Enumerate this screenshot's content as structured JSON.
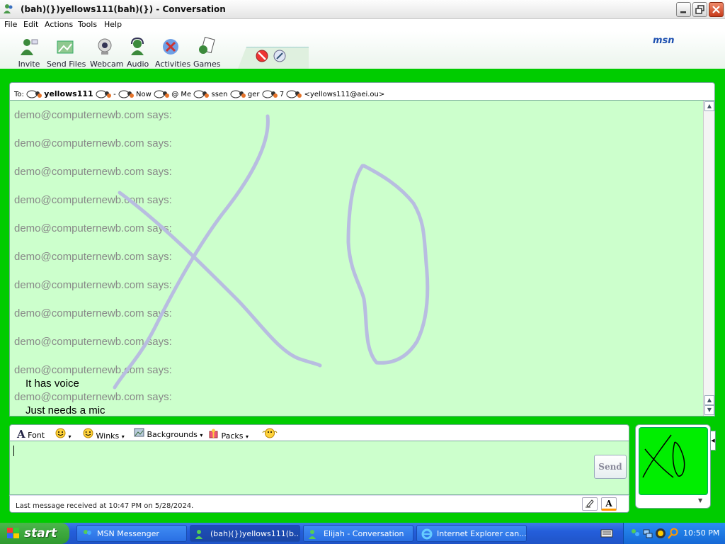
{
  "window": {
    "title": "(bah)(})yellows111(bah)(}) - Conversation"
  },
  "menu": [
    "File",
    "Edit",
    "Actions",
    "Tools",
    "Help"
  ],
  "toolbar": {
    "buttons": [
      "Invite",
      "Send Files",
      "Webcam",
      "Audio",
      "Activities",
      "Games"
    ],
    "brand": "msn"
  },
  "to_bar": {
    "prefix": "To:",
    "nick": "yellows111",
    "fragments": [
      "-",
      "Now",
      "@ Me",
      "ssen",
      "ger",
      "7"
    ],
    "email": "<yellows111@aei.ou>"
  },
  "history": {
    "messages": [
      {
        "sender": "demo@computernewb.com says:",
        "text": ""
      },
      {
        "sender": "demo@computernewb.com says:",
        "text": ""
      },
      {
        "sender": "demo@computernewb.com says:",
        "text": ""
      },
      {
        "sender": "demo@computernewb.com says:",
        "text": ""
      },
      {
        "sender": "demo@computernewb.com says:",
        "text": ""
      },
      {
        "sender": "demo@computernewb.com says:",
        "text": ""
      },
      {
        "sender": "demo@computernewb.com says:",
        "text": ""
      },
      {
        "sender": "demo@computernewb.com says:",
        "text": ""
      },
      {
        "sender": "demo@computernewb.com says:",
        "text": ""
      },
      {
        "sender": "demo@computernewb.com says:",
        "text": "It has voice"
      },
      {
        "sender": "demo@computernewb.com says:",
        "text": "Just needs a mic"
      }
    ]
  },
  "compose": {
    "toolbar": [
      "Font",
      "Winks",
      "Backgrounds",
      "Packs"
    ],
    "send_label": "Send",
    "value": ""
  },
  "status": {
    "text": "Last message received at 10:47 PM on 5/28/2024."
  },
  "taskbar": {
    "start_label": "start",
    "tasks": [
      "MSN Messenger",
      "(bah)(})yellows111(b...",
      "Elijah - Conversation",
      "Internet Explorer can..."
    ],
    "active_index": 1,
    "clock": "10:50 PM"
  },
  "colors": {
    "window_bg": "#00cc00",
    "history_bg": "#ccffcc",
    "ink": "#b8bde0",
    "taskbar": "#245edb"
  }
}
